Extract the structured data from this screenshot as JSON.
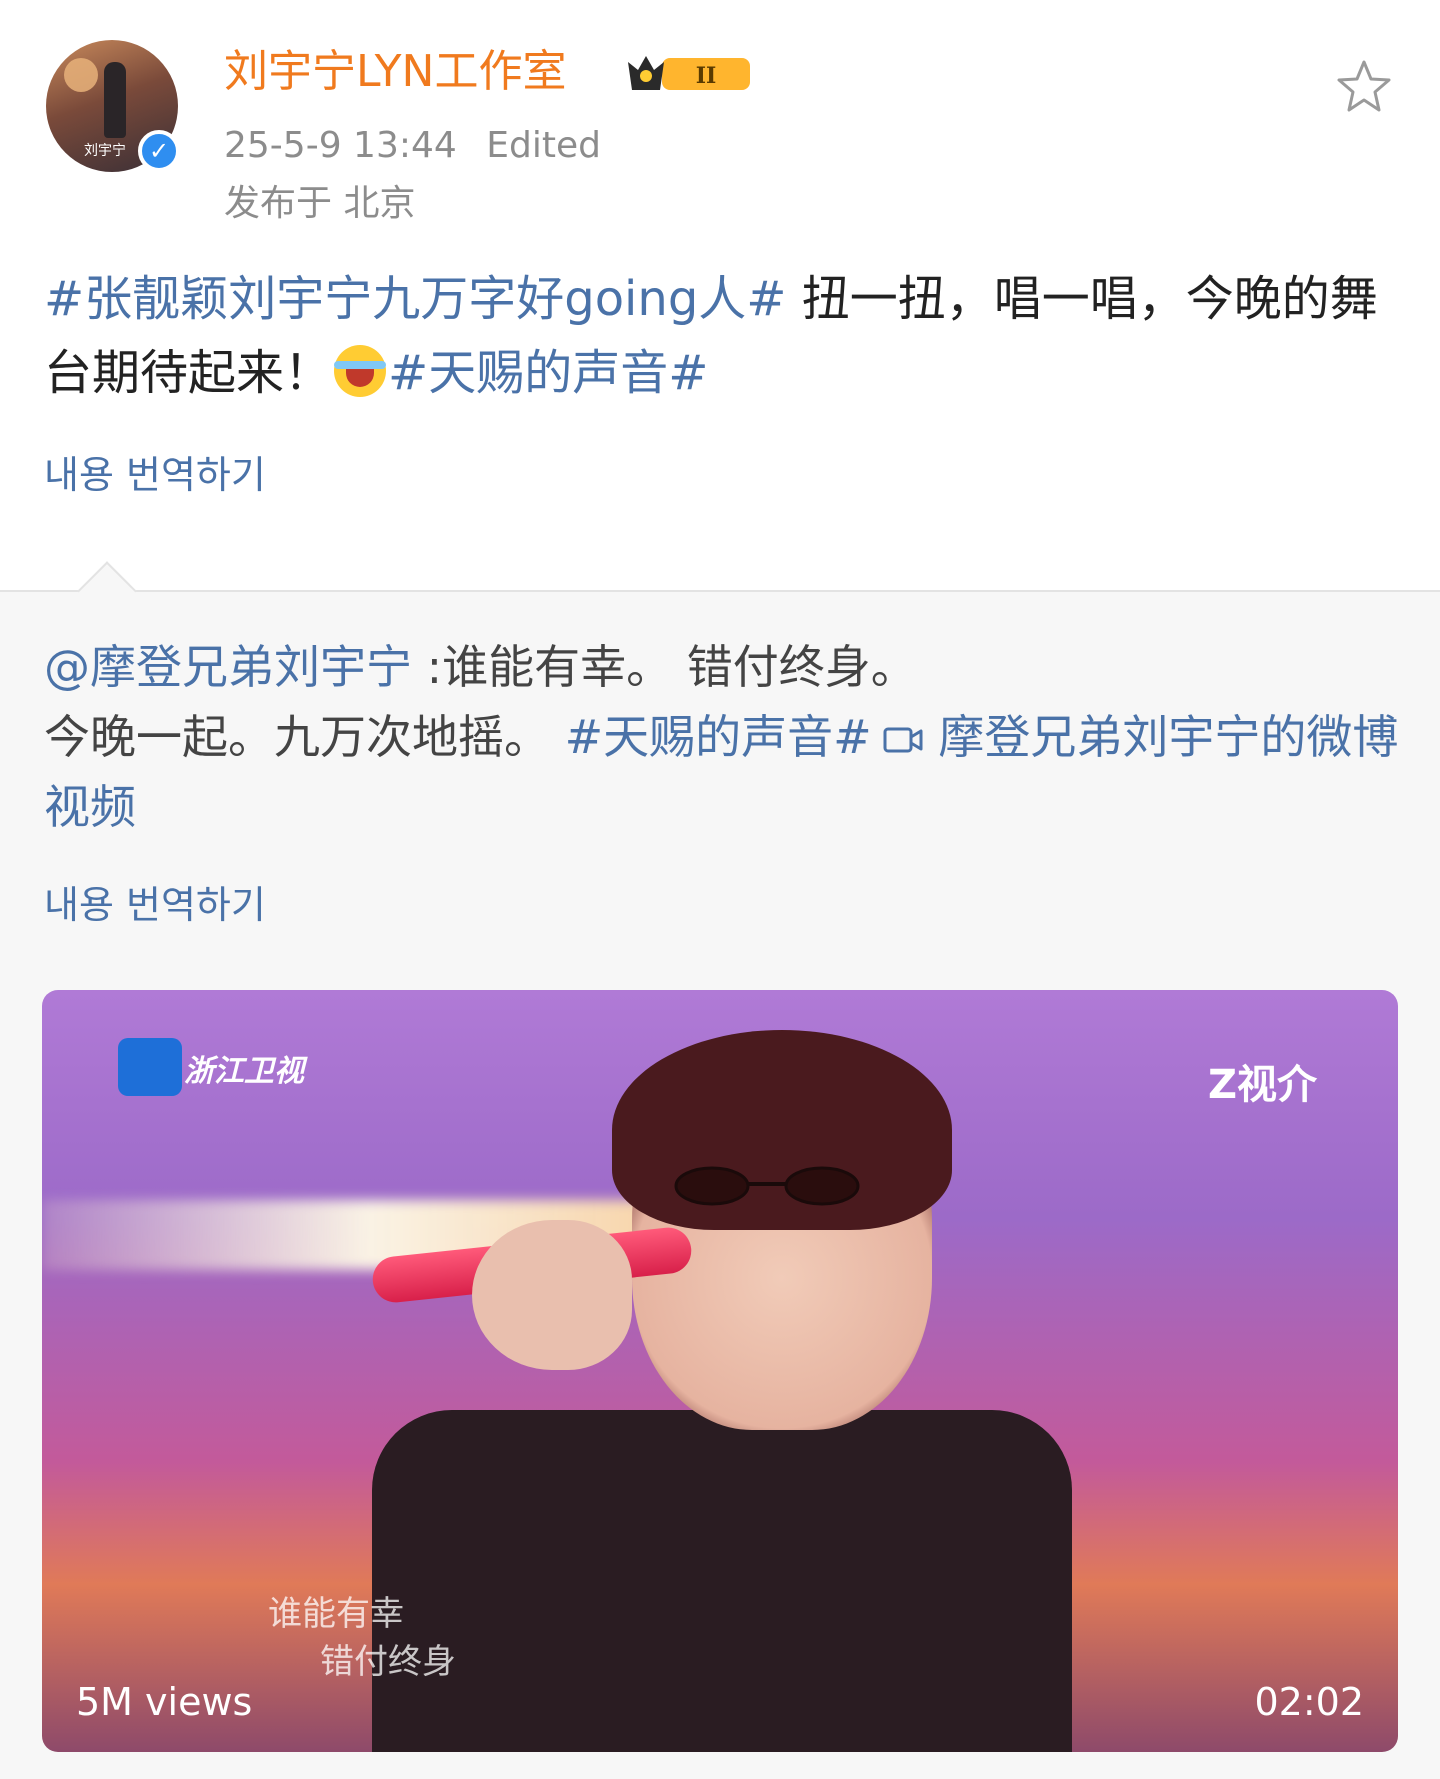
{
  "post": {
    "username": "刘宇宁LYN工作室",
    "level_badge": "II",
    "timestamp": "25-5-9 13:44",
    "edited": "Edited",
    "location": "发布于 北京",
    "text_tag1": "#张靓颖刘宇宁九万字好going人#",
    "text_main1": " 扭一扭，唱一唱，今晚的舞台期待起来！",
    "text_tag2": "#天赐的声音#",
    "translate_label": "내용 번역하기"
  },
  "repost": {
    "mention": "@摩登兄弟刘宇宁",
    "text1": " :谁能有幸。 错付终身。",
    "text2": "今晚一起。九万次地摇。 ",
    "tag": "#天赐的声音#",
    "video_link": " 摩登兄弟刘宇宁的微博视频",
    "translate_label": "내용 번역하기"
  },
  "video": {
    "channel_logo": "浙江卫视",
    "platform_logo": "Z视介",
    "lyric_line1": "谁能有幸",
    "lyric_line2": "错付终身",
    "views": "5M views",
    "duration": "02:02"
  },
  "icons": {
    "favorite": "star-icon",
    "verified": "verified-icon",
    "video_link": "video-camera-icon"
  },
  "colors": {
    "username": "#f07a1e",
    "link": "#4a72a8",
    "meta": "#8c8c8c"
  }
}
